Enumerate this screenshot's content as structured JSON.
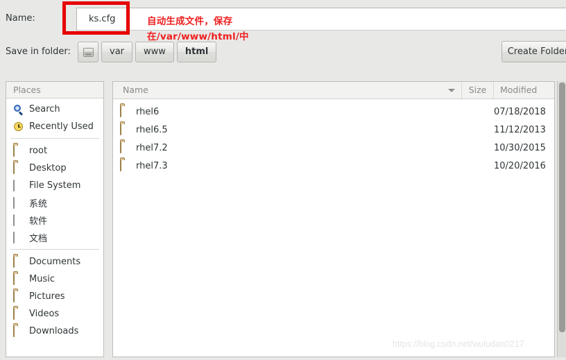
{
  "dialog": {
    "name_label": "Name:",
    "folder_label": "Save in folder:",
    "name_value": "ks.cfg",
    "create_folder_label": "Create Folder"
  },
  "path_bar": {
    "buttons": [
      {
        "label": "",
        "icon": "drive-icon",
        "current": false
      },
      {
        "label": "var",
        "icon": "",
        "current": false
      },
      {
        "label": "www",
        "icon": "",
        "current": false
      },
      {
        "label": "html",
        "icon": "",
        "current": true
      }
    ]
  },
  "annotation": {
    "color": "#ef2020",
    "line1": "自动生成文件，保存",
    "line2": "在/var/www/html/中"
  },
  "sidebar": {
    "header": "Places",
    "items": [
      {
        "label": "Search",
        "icon": "search-icon"
      },
      {
        "label": "Recently Used",
        "icon": "clock-icon"
      },
      {
        "separator": true
      },
      {
        "label": "root",
        "icon": "folder-home-icon"
      },
      {
        "label": "Desktop",
        "icon": "folder-desktop-icon"
      },
      {
        "label": "File System",
        "icon": "drive-icon"
      },
      {
        "label": "系统",
        "icon": "drive-icon"
      },
      {
        "label": "软件",
        "icon": "drive-icon"
      },
      {
        "label": "文档",
        "icon": "drive-icon"
      },
      {
        "separator": true
      },
      {
        "label": "Documents",
        "icon": "folder-documents-icon"
      },
      {
        "label": "Music",
        "icon": "folder-music-icon"
      },
      {
        "label": "Pictures",
        "icon": "folder-pictures-icon"
      },
      {
        "label": "Videos",
        "icon": "folder-videos-icon"
      },
      {
        "label": "Downloads",
        "icon": "folder-downloads-icon"
      }
    ]
  },
  "filelist": {
    "columns": {
      "name": "Name",
      "size": "Size",
      "modified": "Modified"
    },
    "rows": [
      {
        "name": "rhel6",
        "size": "",
        "modified": "07/18/2018"
      },
      {
        "name": "rhel6.5",
        "size": "",
        "modified": "11/12/2013"
      },
      {
        "name": "rhel7.2",
        "size": "",
        "modified": "10/30/2015"
      },
      {
        "name": "rhel7.3",
        "size": "",
        "modified": "10/20/2016"
      }
    ]
  },
  "watermark": {
    "text": "https://blog.csdn.net/wuludan0217"
  }
}
